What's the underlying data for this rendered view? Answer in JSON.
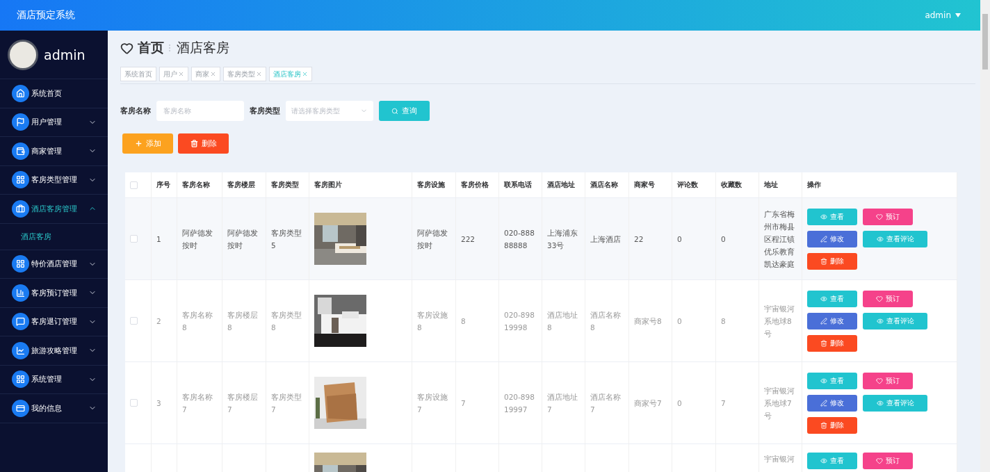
{
  "header": {
    "title": "酒店预定系统",
    "user": "admin"
  },
  "sidebar": {
    "user": "admin",
    "items": [
      {
        "label": "系统首页",
        "kind": "link"
      },
      {
        "label": "用户管理",
        "kind": "menu",
        "expanded": false
      },
      {
        "label": "商家管理",
        "kind": "menu",
        "expanded": false
      },
      {
        "label": "客房类型管理",
        "kind": "menu",
        "expanded": false
      },
      {
        "label": "酒店客房管理",
        "kind": "menu",
        "expanded": true,
        "children": [
          {
            "label": "酒店客房",
            "selected": true
          }
        ]
      },
      {
        "label": "特价酒店管理",
        "kind": "menu",
        "expanded": false
      },
      {
        "label": "客房预订管理",
        "kind": "menu",
        "expanded": false
      },
      {
        "label": "客房退订管理",
        "kind": "menu",
        "expanded": false
      },
      {
        "label": "旅游攻略管理",
        "kind": "menu",
        "expanded": false
      },
      {
        "label": "系统管理",
        "kind": "menu",
        "expanded": false
      },
      {
        "label": "我的信息",
        "kind": "menu",
        "expanded": false
      }
    ]
  },
  "breadcrumb": {
    "home": "首页",
    "current": "酒店客房"
  },
  "tabs": [
    {
      "label": "系统首页",
      "closable": false,
      "selected": false
    },
    {
      "label": "用户",
      "closable": true,
      "selected": false
    },
    {
      "label": "商家",
      "closable": true,
      "selected": false
    },
    {
      "label": "客房类型",
      "closable": true,
      "selected": false
    },
    {
      "label": "酒店客房",
      "closable": true,
      "selected": true
    }
  ],
  "search": {
    "name_label": "客房名称",
    "name_placeholder": "客房名称",
    "type_label": "客房类型",
    "type_placeholder": "请选择客房类型",
    "button": "查询"
  },
  "toolbar": [
    {
      "label": "添加",
      "kind": "add"
    },
    {
      "label": "删除",
      "kind": "delete"
    }
  ],
  "table": {
    "columns": [
      {
        "kind": "check",
        "checked": false
      },
      {
        "label": "序号",
        "kind": "text"
      },
      {
        "label": "客房名称",
        "kind": "text"
      },
      {
        "label": "客房楼层",
        "kind": "text"
      },
      {
        "label": "客房类型",
        "kind": "text"
      },
      {
        "label": "客房图片",
        "kind": "text"
      },
      {
        "label": "客房设施",
        "kind": "text"
      },
      {
        "label": "客房价格",
        "kind": "text"
      },
      {
        "label": "联系电话",
        "kind": "text"
      },
      {
        "label": "酒店地址",
        "kind": "text"
      },
      {
        "label": "酒店名称",
        "kind": "text"
      },
      {
        "label": "商家号",
        "kind": "text"
      },
      {
        "label": "评论数",
        "kind": "text"
      },
      {
        "label": "收藏数",
        "kind": "text"
      },
      {
        "label": "地址",
        "kind": "text"
      },
      {
        "label": "操作",
        "kind": "text"
      }
    ],
    "rows": [
      {
        "hovered": true,
        "cells": [
          {
            "kind": "check",
            "checked": false
          },
          "1",
          "阿萨德发按时",
          "阿萨德发按时",
          "客房类型5",
          {
            "kind": "picture"
          },
          "阿萨德发按时",
          "222",
          "020-88888888",
          "上海浦东33号",
          "上海酒店",
          "22",
          "0",
          "0",
          "广东省梅州市梅县区程江镇优乐教育凯达豪庭",
          {
            "kind": "actions",
            "actions": [
              {
                "label": "查看",
                "kind": "view"
              },
              {
                "label": "预订",
                "kind": "book"
              },
              {
                "label": "修改",
                "kind": "edit"
              },
              {
                "label": "查看评论",
                "kind": "comments"
              },
              {
                "label": "删除",
                "kind": "delete"
              }
            ]
          }
        ]
      },
      {
        "hovered": false,
        "cells": [
          {
            "kind": "check",
            "checked": false
          },
          "2",
          "客房名称8",
          "客房楼层8",
          "客房类型8",
          {
            "kind": "picture"
          },
          "客房设施8",
          "8",
          "020-89819998",
          "酒店地址8",
          "酒店名称8",
          "商家号8",
          "0",
          "8",
          "宇宙银河系地球8号",
          {
            "kind": "actions",
            "actions": [
              {
                "label": "查看",
                "kind": "view"
              },
              {
                "label": "预订",
                "kind": "book"
              },
              {
                "label": "修改",
                "kind": "edit"
              },
              {
                "label": "查看评论",
                "kind": "comments"
              },
              {
                "label": "删除",
                "kind": "delete"
              }
            ]
          }
        ]
      },
      {
        "hovered": false,
        "cells": [
          {
            "kind": "check",
            "checked": false
          },
          "3",
          "客房名称7",
          "客房楼层7",
          "客房类型7",
          {
            "kind": "picture"
          },
          "客房设施7",
          "7",
          "020-89819997",
          "酒店地址7",
          "酒店名称7",
          "商家号7",
          "0",
          "7",
          "宇宙银河系地球7号",
          {
            "kind": "actions",
            "actions": [
              {
                "label": "查看",
                "kind": "view"
              },
              {
                "label": "预订",
                "kind": "book"
              },
              {
                "label": "修改",
                "kind": "edit"
              },
              {
                "label": "查看评论",
                "kind": "comments"
              },
              {
                "label": "删除",
                "kind": "delete"
              }
            ]
          }
        ]
      },
      {
        "hovered": false,
        "partial": true,
        "cells": [
          "",
          "",
          "",
          "",
          "",
          {
            "kind": "picture"
          },
          "",
          "",
          "",
          "",
          "",
          "",
          "",
          "",
          "宇宙银河",
          {
            "kind": "actions",
            "actions": [
              {
                "label": "查看",
                "kind": "view"
              },
              {
                "label": "预订",
                "kind": "book"
              }
            ]
          }
        ]
      }
    ]
  }
}
